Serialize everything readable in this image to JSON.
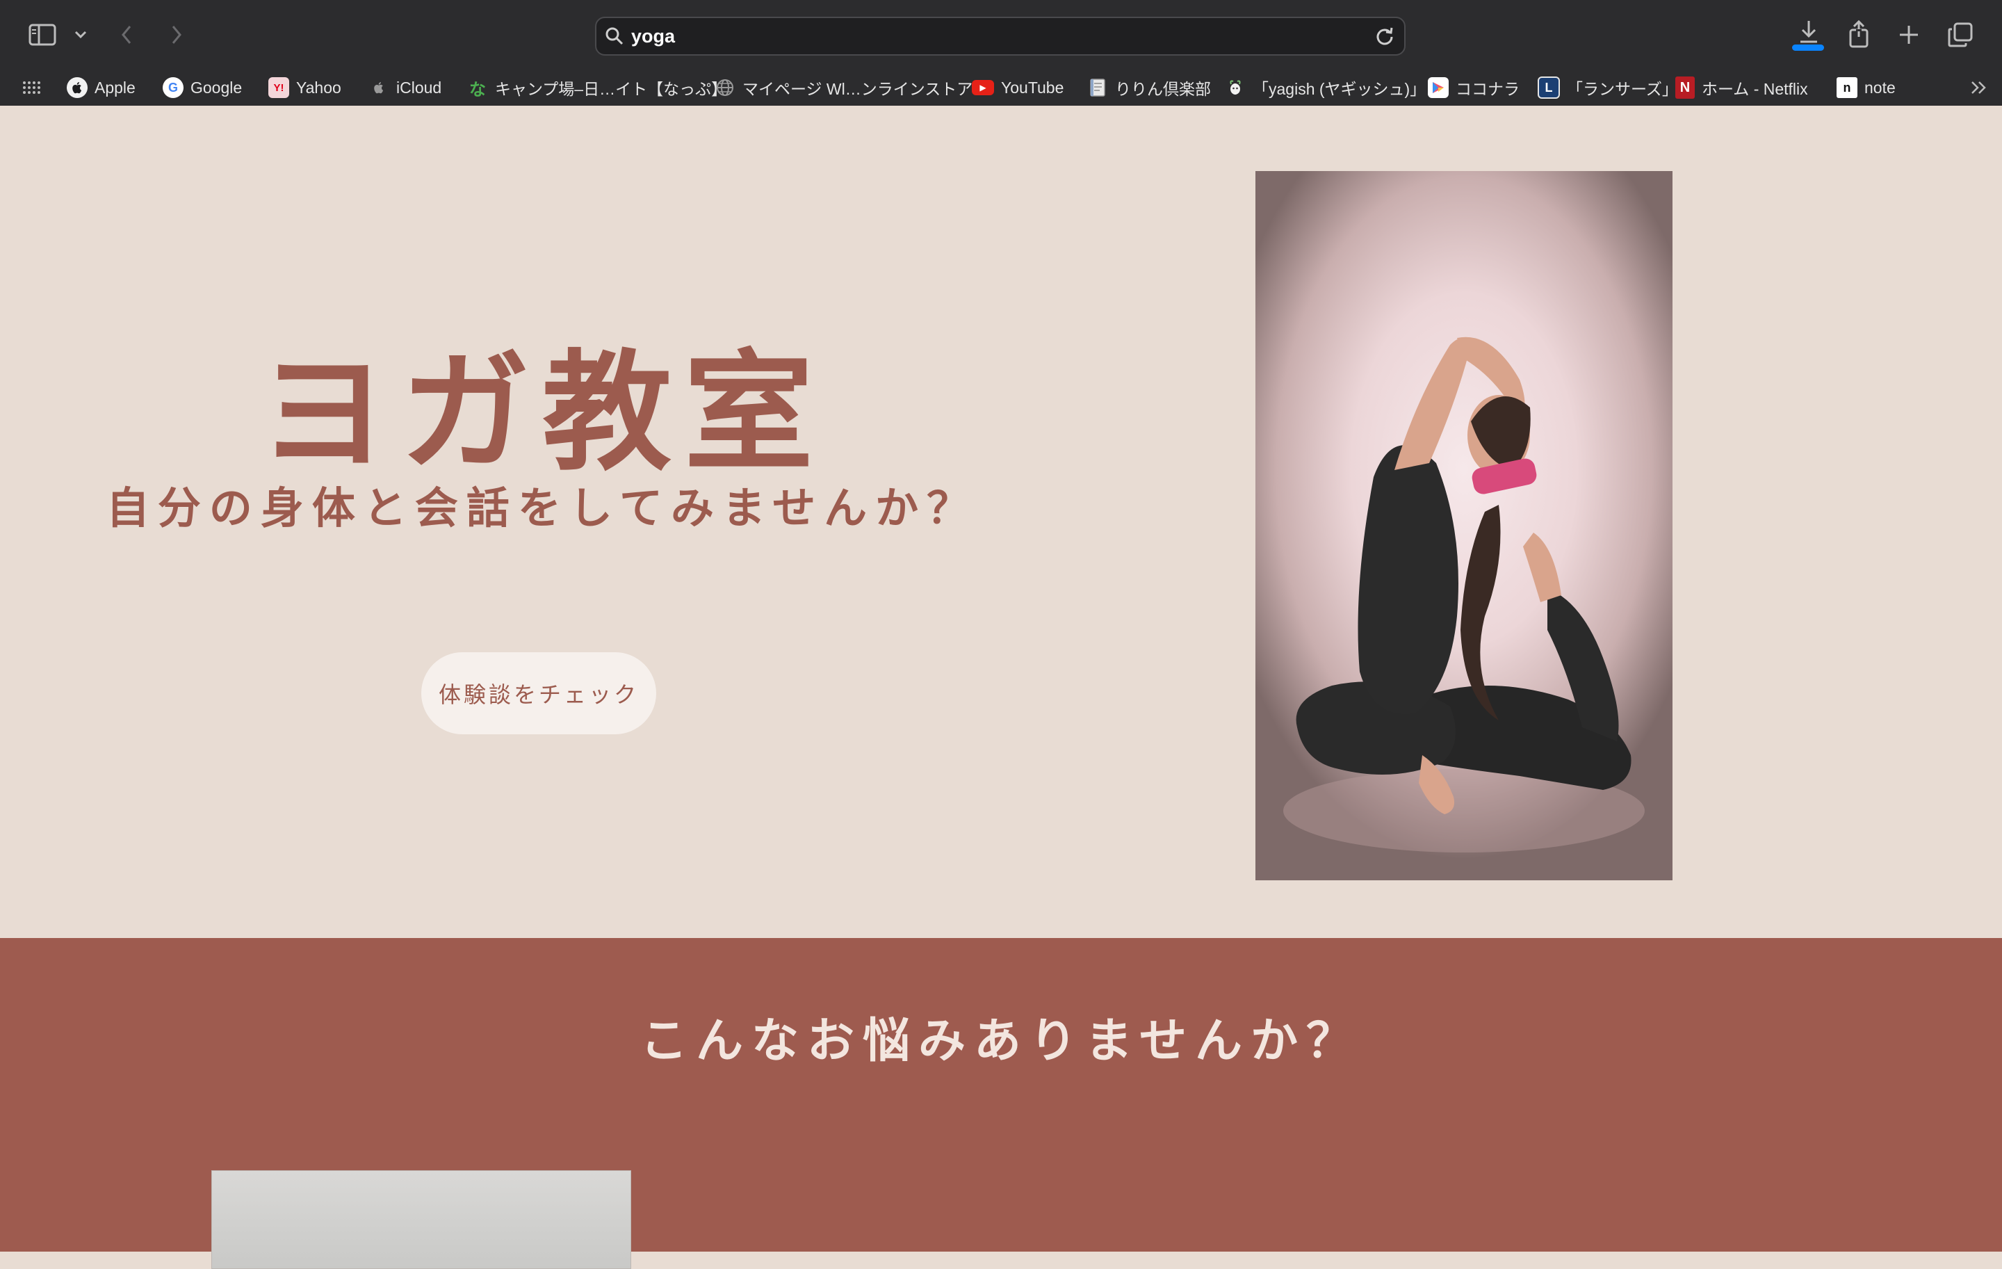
{
  "browser": {
    "address_bar": {
      "value": "yoga"
    },
    "bookmarks": [
      {
        "label": "Apple",
        "icon": "apple-icon"
      },
      {
        "label": "Google",
        "icon": "google-icon"
      },
      {
        "label": "Yahoo",
        "icon": "yahoo-icon"
      },
      {
        "label": "iCloud",
        "icon": "apple-icon"
      },
      {
        "label": "キャンプ場–日…イト【なっぷ】",
        "icon": "nap-icon"
      },
      {
        "label": "マイページ Wl…ンラインストア",
        "icon": "globe-icon"
      },
      {
        "label": "YouTube",
        "icon": "youtube-icon"
      },
      {
        "label": "りりん倶楽部",
        "icon": "page-icon"
      },
      {
        "label": "「yagish (ヤギッシュ)」",
        "icon": "goat-icon"
      },
      {
        "label": "ココナラ",
        "icon": "coconala-icon"
      },
      {
        "label": "「ランサーズ」",
        "icon": "lancers-icon"
      },
      {
        "label": "ホーム - Netflix",
        "icon": "netflix-icon"
      },
      {
        "label": "note",
        "icon": "note-icon"
      }
    ],
    "favicon_glyphs": {
      "google": "G",
      "yahoo": "Y!",
      "nap": "な",
      "youtube": "▶",
      "lancers": "L",
      "netflix": "N",
      "note": "n"
    },
    "colors": {
      "download_progress": "#0a84ff"
    }
  },
  "hero": {
    "title": "ヨガ教室",
    "subtitle": "自分の身体と会話をしてみませんか？",
    "cta_label": "体験談をチェック"
  },
  "problems": {
    "title": "こんなお悩みありませんか？"
  },
  "colors": {
    "accent": "#9c5b4e",
    "hero_bg": "#e8dcd3",
    "section_bg": "#9e5b4f",
    "button_bg": "#f6f0ec"
  }
}
